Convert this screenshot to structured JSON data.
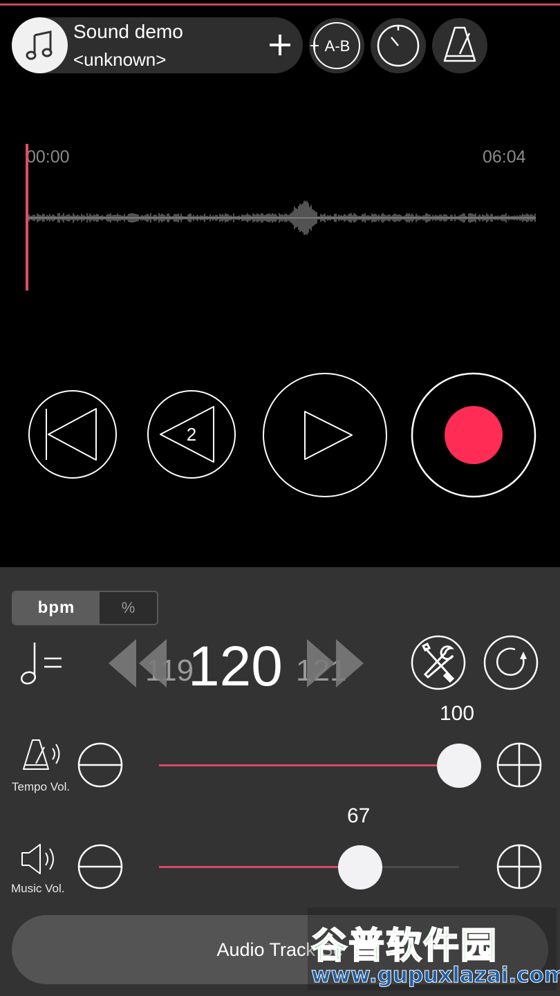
{
  "header": {
    "title": "Sound demo",
    "artist": "<unknown>",
    "ab_label": "A-B"
  },
  "waveform": {
    "time_start": "00:00",
    "time_end": "06:04",
    "playhead_position": 0
  },
  "transport": {
    "rewind_seconds": "2"
  },
  "tempo": {
    "unit_bpm": "bpm",
    "unit_percent": "%",
    "selected_unit": "bpm",
    "value": "120",
    "prev_value": "119",
    "next_value": "121"
  },
  "sliders": {
    "tempo_vol": {
      "label": "Tempo Vol.",
      "value": "100",
      "fraction": 1.0
    },
    "music_vol": {
      "label": "Music Vol.",
      "value": "67",
      "fraction": 0.67
    }
  },
  "footer": {
    "audio_track_label": "Audio Track Se"
  },
  "watermark": {
    "logo_text": "谷普软件园",
    "url": "www.gupuxlazai.com"
  },
  "colors": {
    "accent": "#e44b66",
    "record": "#ff2d55",
    "panel": "#333333"
  }
}
